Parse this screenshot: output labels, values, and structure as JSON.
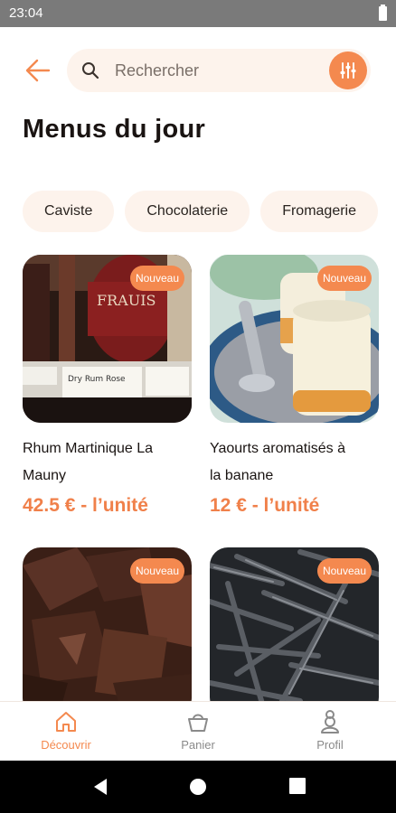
{
  "status": {
    "time": "23:04"
  },
  "search": {
    "placeholder": "Rechercher"
  },
  "page": {
    "title": "Menus du jour"
  },
  "categories": [
    "Caviste",
    "Chocolaterie",
    "Fromagerie"
  ],
  "products": [
    {
      "title_line1": "Rhum Martinique La",
      "title_line2": "Mauny",
      "price": "42.5 € - l’unité",
      "badge": "Nouveau",
      "image_icon": "bottles-photo"
    },
    {
      "title_line1": "Yaourts aromatisés à",
      "title_line2": "la banane",
      "price": "12 € - l’unité",
      "badge": "Nouveau",
      "image_icon": "yogurt-jars-photo"
    },
    {
      "badge": "Nouveau",
      "image_icon": "chocolate-pieces-photo"
    },
    {
      "badge": "Nouveau",
      "image_icon": "vanilla-pods-photo"
    }
  ],
  "nav": {
    "discover": "Découvrir",
    "cart": "Panier",
    "profile": "Profil"
  },
  "colors": {
    "accent": "#f4894f",
    "chip_bg": "#fdf3ec",
    "text_dark": "#1a1412"
  }
}
